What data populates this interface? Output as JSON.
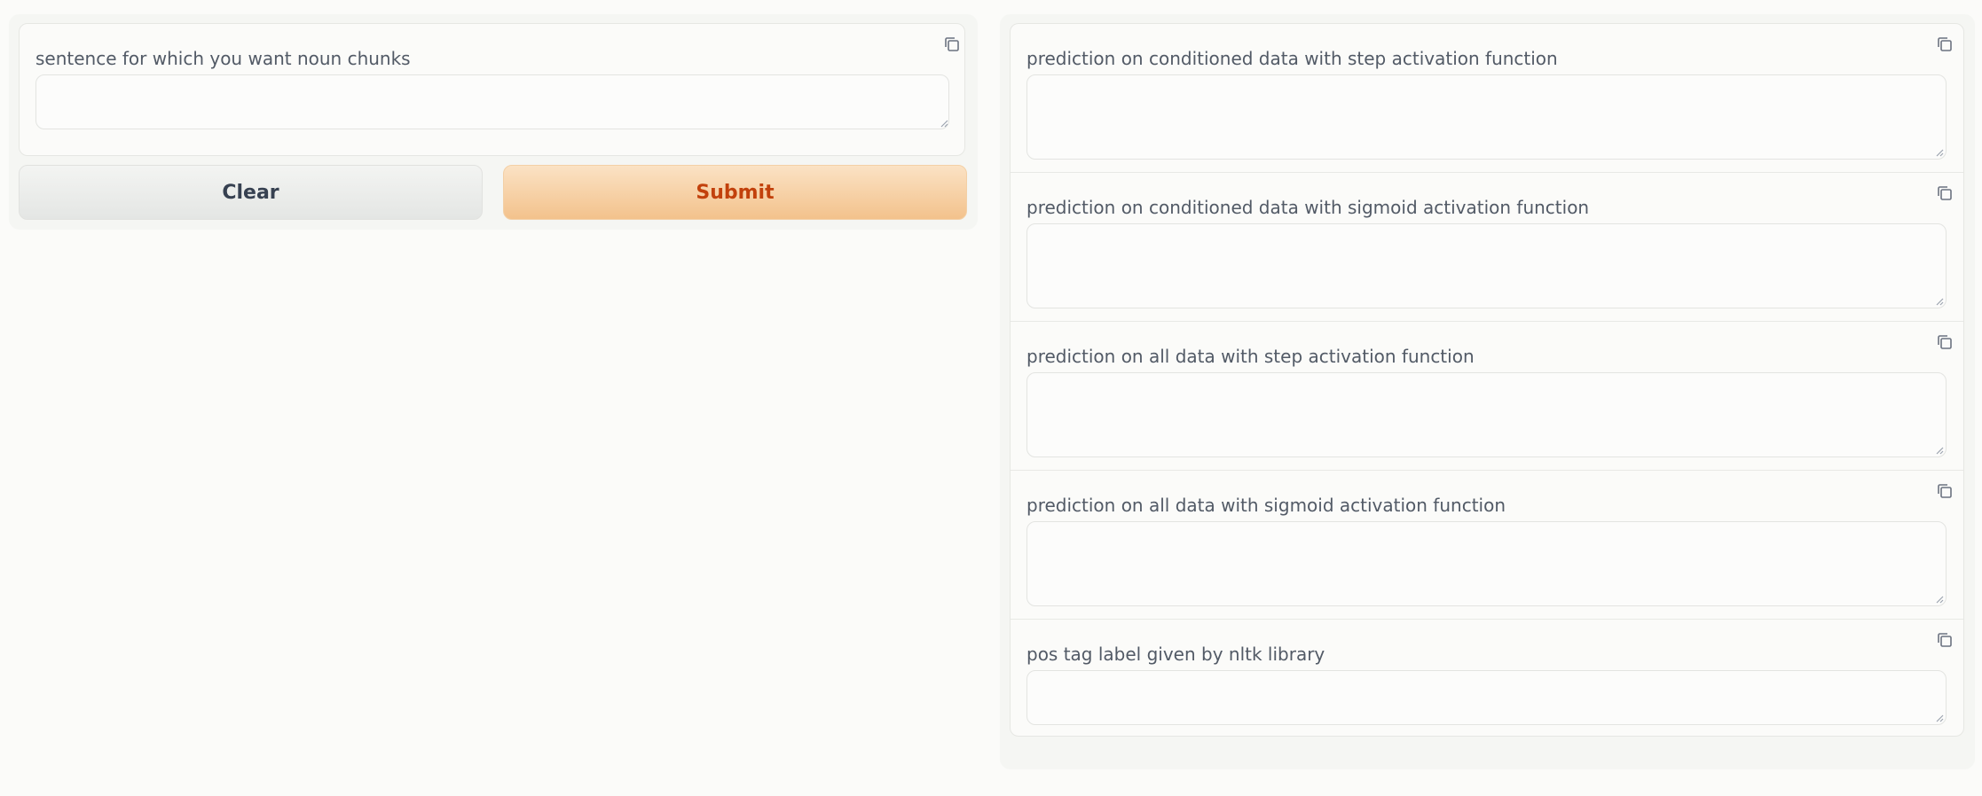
{
  "input": {
    "label": "sentence for which you want noun chunks",
    "value": "",
    "copy_icon": "copy-icon"
  },
  "buttons": {
    "clear_label": "Clear",
    "submit_label": "Submit"
  },
  "outputs": [
    {
      "label": "prediction on conditioned data with step activation function",
      "value": ""
    },
    {
      "label": "prediction on conditioned data with sigmoid activation function",
      "value": ""
    },
    {
      "label": "prediction on all data with step activation function",
      "value": ""
    },
    {
      "label": "prediction on all data with sigmoid activation function",
      "value": ""
    },
    {
      "label": "pos tag label given by nltk library",
      "value": ""
    }
  ],
  "colors": {
    "background": "#fbfbf9",
    "submit_accent": "#c2410c",
    "submit_fill": "#f3c28c",
    "clear_fill": "#e4e6e4"
  }
}
